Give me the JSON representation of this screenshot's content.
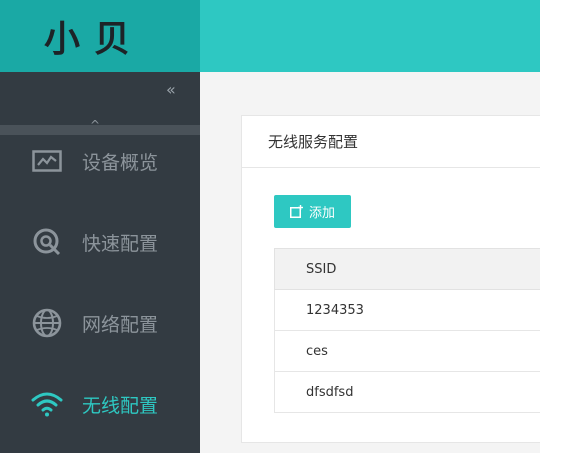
{
  "brand": {
    "logo_text": "小贝",
    "primary_color": "#2ec8c2",
    "logo_bg": "#1aa9a5",
    "sidebar_bg": "#333b42"
  },
  "sidebar": {
    "collapse_glyph": "«",
    "scroll_up_glyph": "^",
    "items": [
      {
        "label": "设备概览",
        "icon": "chart-monitor-icon",
        "active": false
      },
      {
        "label": "快速配置",
        "icon": "quick-setup-icon",
        "active": false
      },
      {
        "label": "网络配置",
        "icon": "globe-icon",
        "active": false
      },
      {
        "label": "无线配置",
        "icon": "wifi-icon",
        "active": true
      }
    ]
  },
  "panel": {
    "title": "无线服务配置",
    "add_button_label": "添加",
    "table": {
      "columns": [
        "SSID"
      ],
      "rows": [
        "1234353",
        "ces",
        "dfsdfsd"
      ]
    }
  }
}
